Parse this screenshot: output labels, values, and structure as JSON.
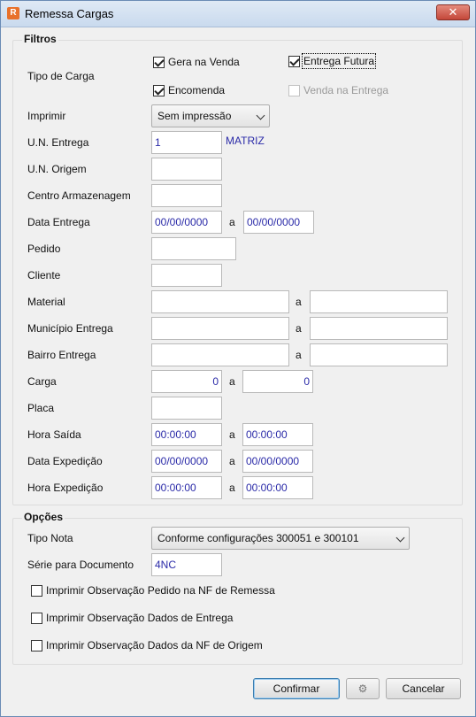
{
  "window": {
    "title": "Remessa Cargas",
    "close_symbol": "✕",
    "app_icon_glyph": "R"
  },
  "filtros": {
    "title": "Filtros",
    "tipo_carga_label": "Tipo de Carga",
    "gera_na_venda": "Gera na Venda",
    "entrega_futura": "Entrega Futura",
    "encomenda": "Encomenda",
    "venda_na_entrega": "Venda na Entrega",
    "imprimir_label": "Imprimir",
    "imprimir_value": "Sem impressão",
    "un_entrega_label": "U.N. Entrega",
    "un_entrega_value": "1",
    "un_entrega_desc": "MATRIZ",
    "un_origem_label": "U.N. Origem",
    "centro_label": "Centro Armazenagem",
    "data_entrega_label": "Data Entrega",
    "data_entrega_de": "00/00/0000",
    "data_entrega_ate": "00/00/0000",
    "pedido_label": "Pedido",
    "cliente_label": "Cliente",
    "material_label": "Material",
    "municipio_label": "Município Entrega",
    "bairro_label": "Bairro Entrega",
    "carga_label": "Carga",
    "carga_de": "0",
    "carga_ate": "0",
    "placa_label": "Placa",
    "hora_saida_label": "Hora Saída",
    "hora_saida_de": "00:00:00",
    "hora_saida_ate": "00:00:00",
    "data_exped_label": "Data Expedição",
    "data_exped_de": "00/00/0000",
    "data_exped_ate": "00/00/0000",
    "hora_exped_label": "Hora Expedição",
    "hora_exped_de": "00:00:00",
    "hora_exped_ate": "00:00:00",
    "range_sep": "a"
  },
  "opcoes": {
    "title": "Opções",
    "tipo_nota_label": "Tipo Nota",
    "tipo_nota_value": "Conforme configurações 300051 e 300101",
    "serie_label": "Série para Documento",
    "serie_value": "4NC",
    "obs_pedido": "Imprimir Observação Pedido na NF de Remessa",
    "obs_entrega": "Imprimir Observação Dados de Entrega",
    "obs_origem": "Imprimir Observação Dados da NF de Origem"
  },
  "buttons": {
    "confirmar": "Confirmar",
    "settings_glyph": "⚙",
    "cancelar": "Cancelar"
  }
}
